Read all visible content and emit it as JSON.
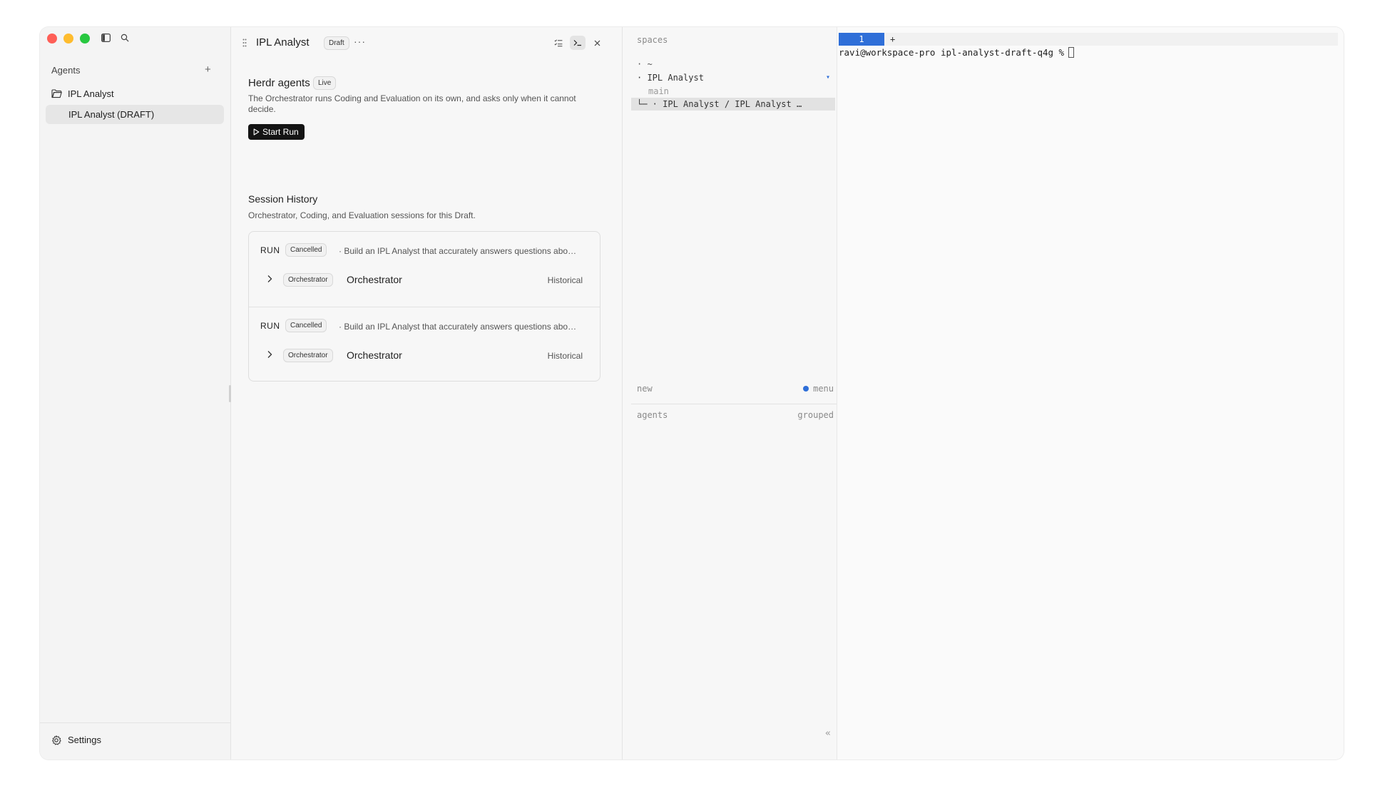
{
  "sidebar": {
    "agents_header": "Agents",
    "add_label": "+",
    "folder_name": "IPL Analyst",
    "draft_item": "IPL Analyst (DRAFT)",
    "settings_label": "Settings"
  },
  "panel": {
    "title": "IPL Analyst",
    "status_badge": "Draft",
    "more_label": "···",
    "herdr": {
      "title": "Herdr agents",
      "badge": "Live",
      "description": "The Orchestrator runs Coding and Evaluation on its own, and asks only when it cannot decide.",
      "start_label": "Start Run"
    },
    "session_history": {
      "title": "Session History",
      "subtitle": "Orchestrator, Coding, and Evaluation sessions for this Draft.",
      "runs": [
        {
          "label": "RUN",
          "status": "Cancelled",
          "description": "· Build an IPL Analyst that accurately answers questions abo…",
          "agent_badge": "Orchestrator",
          "agent_name": "Orchestrator",
          "state": "Historical"
        },
        {
          "label": "RUN",
          "status": "Cancelled",
          "description": "· Build an IPL Analyst that accurately answers questions abo…",
          "agent_badge": "Orchestrator",
          "agent_name": "Orchestrator",
          "state": "Historical"
        }
      ]
    }
  },
  "spaces": {
    "label": "spaces",
    "home": "· ~",
    "workspace": "·  IPL Analyst",
    "caret": "▾",
    "branch": "main",
    "item": "└─ · IPL Analyst / IPL Analyst …",
    "new_label": "new",
    "menu_label": "menu",
    "agents_label": "agents",
    "grouped_label": "grouped",
    "collapse_label": "«"
  },
  "terminal": {
    "tab_label": "1",
    "add_tab_label": "+",
    "prompt": "ravi@workspace-pro ipl-analyst-draft-q4g %"
  },
  "colors": {
    "accent": "#2f6fd8",
    "close_dot": "#fe5f57",
    "minimize_dot": "#febc2e",
    "maximize_dot": "#28c840",
    "primary_button": "#141414"
  }
}
